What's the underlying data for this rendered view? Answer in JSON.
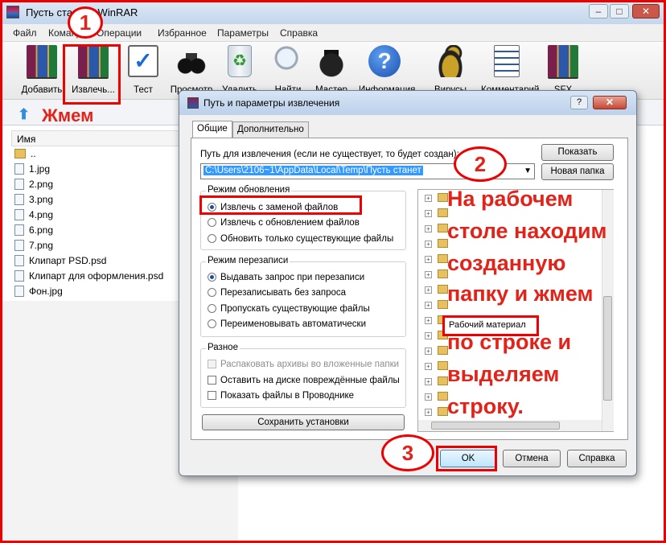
{
  "window": {
    "title": "Пусть станет - WinRAR",
    "controls": {
      "minimize": "–",
      "maximize": "□",
      "close": "✕"
    }
  },
  "menu": [
    "Файл",
    "Команды",
    "Операции",
    "Избранное",
    "Параметры",
    "Справка"
  ],
  "toolbar": [
    {
      "label": "Добавить",
      "icon": "rar-add-icon"
    },
    {
      "label": "Извлечь...",
      "icon": "rar-extract-icon"
    },
    {
      "label": "Тест",
      "icon": "clipboard-test-icon"
    },
    {
      "label": "Просмотр",
      "icon": "binoculars-icon"
    },
    {
      "label": "Удалить",
      "icon": "trash-icon"
    },
    {
      "label": "Найти",
      "icon": "magnifier-icon"
    },
    {
      "label": "Мастер",
      "icon": "wizard-icon"
    },
    {
      "label": "Информация",
      "icon": "info-icon"
    },
    {
      "label": "Вирусы",
      "icon": "virus-icon"
    },
    {
      "label": "Комментарий",
      "icon": "comment-icon"
    },
    {
      "label": "SFX",
      "icon": "sfx-icon"
    }
  ],
  "file_list": {
    "column_name": "Имя",
    "items": [
      {
        "name": "..",
        "type": "folder"
      },
      {
        "name": "1.jpg",
        "type": "file"
      },
      {
        "name": "2.png",
        "type": "file"
      },
      {
        "name": "3.png",
        "type": "file"
      },
      {
        "name": "4.png",
        "type": "file"
      },
      {
        "name": "6.png",
        "type": "file"
      },
      {
        "name": "7.png",
        "type": "file"
      },
      {
        "name": "Клипарт PSD.psd",
        "type": "file"
      },
      {
        "name": "Клипарт для оформления.psd",
        "type": "file"
      },
      {
        "name": "Фон.jpg",
        "type": "file"
      }
    ]
  },
  "dialog": {
    "title": "Путь и параметры извлечения",
    "help_label": "?",
    "close_label": "✕",
    "tabs": [
      "Общие",
      "Дополнительно"
    ],
    "path_label": "Путь для извлечения (если не существует, то будет создан):",
    "path_value": "C:\\Users\\2106~1\\AppData\\Local\\Temp\\Пусть станет",
    "show_button": "Показать",
    "new_folder_button": "Новая папка",
    "update_mode": {
      "title": "Режим обновления",
      "options": [
        "Извлечь с заменой файлов",
        "Извлечь с обновлением файлов",
        "Обновить только существующие файлы"
      ],
      "selected": 0
    },
    "overwrite_mode": {
      "title": "Режим перезаписи",
      "options": [
        "Выдавать запрос при перезаписи",
        "Перезаписывать без запроса",
        "Пропускать существующие файлы",
        "Переименовывать автоматически"
      ],
      "selected": 0
    },
    "misc": {
      "title": "Разное",
      "options": [
        "Распаковать архивы во вложенные папки",
        "Оставить на диске повреждённые файлы",
        "Показать файлы в Проводнике"
      ],
      "disabled": [
        true,
        false,
        false
      ]
    },
    "save_button": "Сохранить установки",
    "tree_selected_folder": "Рабочий материал",
    "ok_button": "OK",
    "cancel_button": "Отмена",
    "help_button": "Справка"
  },
  "annotations": {
    "step1": "1",
    "step2": "2",
    "step3": "3",
    "press": "Жмем",
    "instruction_lines": [
      "На рабочем",
      "столе находим",
      "созданную",
      "папку и жмем",
      "по строке и",
      "выделяем",
      "строку."
    ]
  }
}
